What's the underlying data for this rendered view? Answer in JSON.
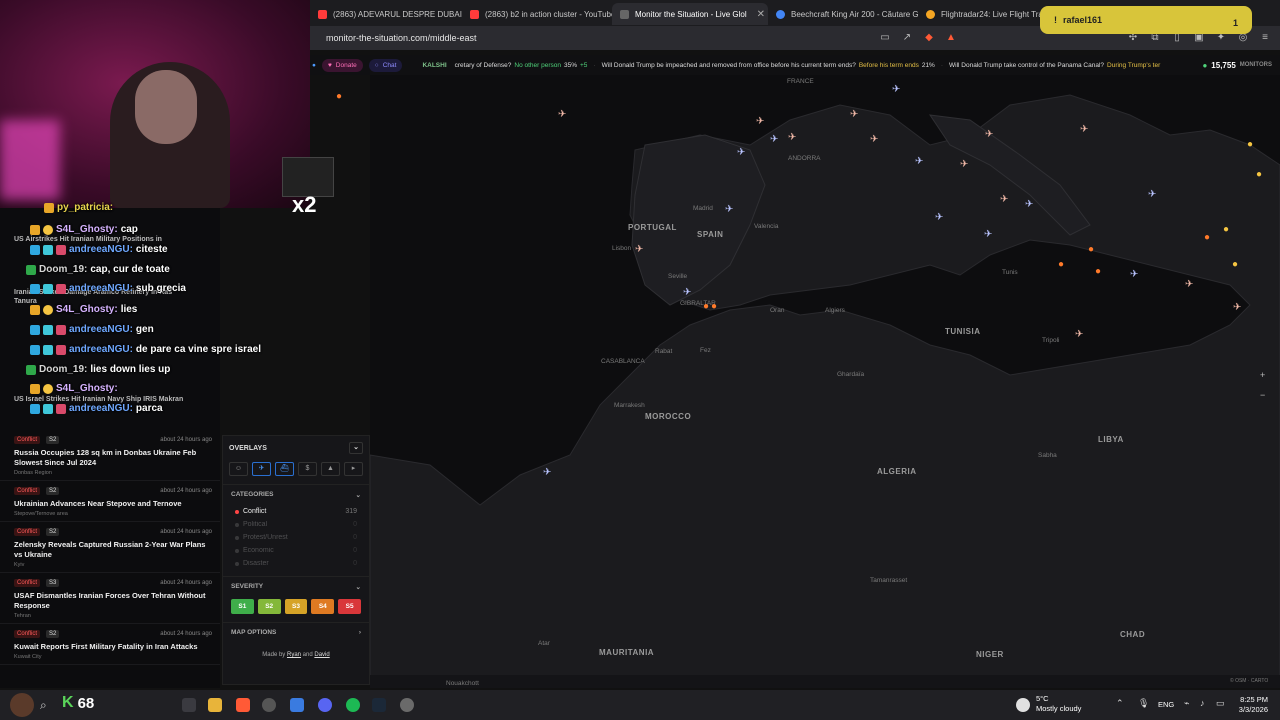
{
  "browser": {
    "tabs": [
      {
        "label": "(2863) ADEVARUL DESPRE DUBAI - Y",
        "color": "#ff3b3b",
        "active": false
      },
      {
        "label": "(2863) b2 in action cluster - YouTube",
        "color": "#ff3b3b",
        "active": false
      },
      {
        "label": "Monitor the Situation - Live Glol",
        "color": "#666666",
        "active": true
      },
      {
        "label": "Beechcraft King Air 200 - Căutare Go",
        "color": "#4285f4",
        "active": false
      },
      {
        "label": "Flightradar24: Live Flight Tracke",
        "color": "#f5a623",
        "active": false
      }
    ],
    "url": "monitor-the-situation.com/middle-east",
    "notification": {
      "user": "rafael161",
      "count": "1"
    }
  },
  "ticker": {
    "donate": "Donate",
    "chat": "Chat",
    "kalshi": "KALSHI",
    "items": [
      {
        "q": "cretary of Defense?",
        "a": "No other person",
        "p": "35%",
        "d": "+5"
      },
      {
        "q": "Will Donald Trump be impeached and removed from office before his current term ends?",
        "a": "Before his term ends",
        "p": "21%",
        "d": ""
      },
      {
        "q": "Will Donald Trump take control of the Panama Canal?",
        "a": "During Trump's ter",
        "p": "",
        "d": ""
      }
    ],
    "monitors_count": "15,755",
    "monitors_label": "MONITORS"
  },
  "stream": {
    "multiplier": "x2"
  },
  "chat": [
    {
      "user": "py_patricia:",
      "msg": "",
      "color": "#e8d44d"
    },
    {
      "user": "S4L_Ghosty:",
      "msg": "cap",
      "color": "#d6b3ff"
    },
    {
      "user": "andreeaNGU:",
      "msg": "citeste",
      "color": "#6fa8ff"
    },
    {
      "user": "Doom_19:",
      "msg": "cap, cur de toate",
      "color": "#d6d6d6"
    },
    {
      "user": "andreeaNGU:",
      "msg": "sub grecia",
      "color": "#6fa8ff"
    },
    {
      "user": "S4L_Ghosty:",
      "msg": "lies",
      "color": "#d6b3ff"
    },
    {
      "user": "andreeaNGU:",
      "msg": "gen",
      "color": "#6fa8ff"
    },
    {
      "user": "andreeaNGU:",
      "msg": "de pare ca vine spre israel",
      "color": "#6fa8ff"
    },
    {
      "user": "Doom_19:",
      "msg": "lies down lies up",
      "color": "#d6d6d6"
    },
    {
      "user": "S4L_Ghosty:",
      "msg": "",
      "color": "#d6b3ff"
    },
    {
      "user": "andreeaNGU:",
      "msg": "parca",
      "color": "#6fa8ff"
    }
  ],
  "news_hidden": [
    "US Airstrikes Hit Iranian Military Positions in",
    "Iranian Strikes Damage Aramco Refinery in Ras Tanura",
    "US Israel Strikes Hit Iranian Navy Ship IRIS Makran"
  ],
  "news": [
    {
      "tag": "Conflict",
      "sev": "S2",
      "ago": "about 24 hours ago",
      "title": "Russia Occupies 128 sq km in Donbas Ukraine Feb Slowest Since Jul 2024",
      "loc": "Donbas Region"
    },
    {
      "tag": "Conflict",
      "sev": "S2",
      "ago": "about 24 hours ago",
      "title": "Ukrainian Advances Near Stepove and Ternove",
      "loc": "Stepove/Ternove area"
    },
    {
      "tag": "Conflict",
      "sev": "S2",
      "ago": "about 24 hours ago",
      "title": "Zelensky Reveals Captured Russian 2-Year War Plans vs Ukraine",
      "loc": "Kyiv"
    },
    {
      "tag": "Conflict",
      "sev": "S3",
      "ago": "about 24 hours ago",
      "title": "USAF Dismantles Iranian Forces Over Tehran Without Response",
      "loc": "Tehran"
    },
    {
      "tag": "Conflict",
      "sev": "S2",
      "ago": "about 24 hours ago",
      "title": "Kuwait Reports First Military Fatality in Iran Attacks",
      "loc": "Kuwait City"
    }
  ],
  "panel": {
    "overlays_label": "OVERLAYS",
    "categories_label": "CATEGORIES",
    "categories": [
      {
        "name": "Conflict",
        "count": "319",
        "color": "#ff4545"
      },
      {
        "name": "Political",
        "count": "0",
        "color": "#444"
      },
      {
        "name": "Protest/Unrest",
        "count": "0",
        "color": "#444"
      },
      {
        "name": "Economic",
        "count": "0",
        "color": "#444"
      },
      {
        "name": "Disaster",
        "count": "0",
        "color": "#444"
      }
    ],
    "severity_label": "SEVERITY",
    "severity": [
      {
        "label": "S1",
        "color": "#3fae4a"
      },
      {
        "label": "S2",
        "color": "#84b83a"
      },
      {
        "label": "S3",
        "color": "#d6a327"
      },
      {
        "label": "S4",
        "color": "#df7a22"
      },
      {
        "label": "S5",
        "color": "#d9373a"
      }
    ],
    "map_options_label": "MAP OPTIONS",
    "credit_prefix": "Made by",
    "credit_a": "Ryan",
    "credit_and": "and",
    "credit_b": "David"
  },
  "map": {
    "labels": [
      "PORTUGAL",
      "SPAIN",
      "MOROCCO",
      "ALGERIA",
      "MAURITANIA",
      "TUNISIA",
      "LIBYA",
      "NIGER",
      "CHAD",
      "ANDORRA",
      "FRANCE",
      "GIBRALTAR",
      "CASABLANCA"
    ],
    "cities": [
      "Madrid",
      "Lisbon",
      "Valencia",
      "Seville",
      "Algiers",
      "Oran",
      "Rabat",
      "Fez",
      "Marrakesh",
      "Ghardaïa",
      "Tamanrasset",
      "Atar",
      "Nouakchott",
      "Tunis",
      "Tripoli",
      "Sabha"
    ],
    "attribution": "© OSM · CARTO"
  },
  "taskbar": {
    "counter": "68",
    "weather_temp": "5°C",
    "weather_desc": "Mostly cloudy",
    "lang": "ENG",
    "time": "8:25 PM",
    "date": "3/3/2026"
  }
}
